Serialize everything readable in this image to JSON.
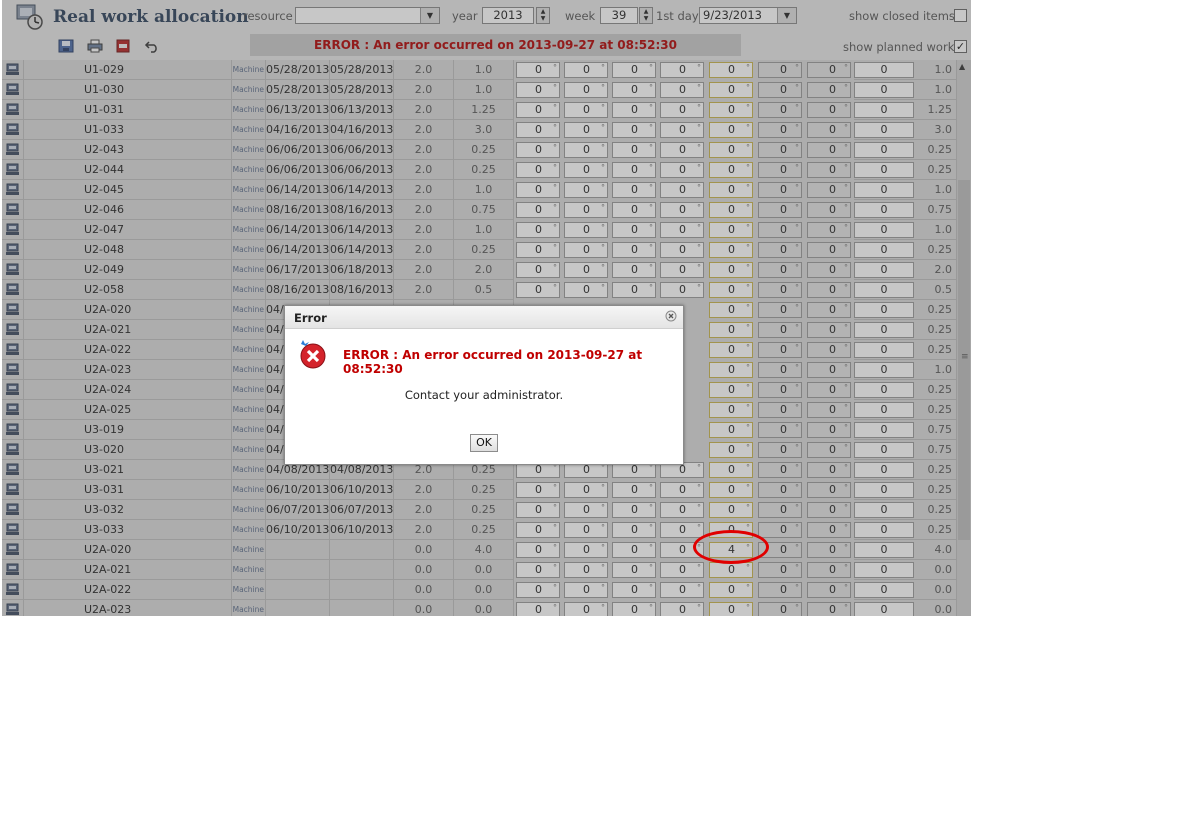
{
  "header": {
    "title": "Real work allocation",
    "resource_label": "resource",
    "resource_value": "",
    "year_label": "year",
    "year_value": "2013",
    "week_label": "week",
    "week_value": "39",
    "first_day_label": "1st day",
    "first_day_value": "9/23/2013",
    "show_closed_label": "show closed items",
    "show_closed_checked": false
  },
  "toolbar": {
    "icons": [
      "save-icon",
      "print-icon",
      "pdf-icon",
      "undo-icon"
    ],
    "error_text": "ERROR : An error occurred on 2013-09-27 at 08:52:30",
    "show_planned_label": "show planned work",
    "show_planned_checked": true
  },
  "grid": {
    "rows": [
      {
        "name": "U1-029",
        "type": "Machine",
        "start": "05/28/2013",
        "end": "05/28/2013",
        "v1": "2.0",
        "v2": "1.0",
        "days": [
          "0",
          "0",
          "0",
          "0",
          "0",
          "0",
          "0",
          "0"
        ],
        "total": "1.0"
      },
      {
        "name": "U1-030",
        "type": "Machine",
        "start": "05/28/2013",
        "end": "05/28/2013",
        "v1": "2.0",
        "v2": "1.0",
        "days": [
          "0",
          "0",
          "0",
          "0",
          "0",
          "0",
          "0",
          "0"
        ],
        "total": "1.0"
      },
      {
        "name": "U1-031",
        "type": "Machine",
        "start": "06/13/2013",
        "end": "06/13/2013",
        "v1": "2.0",
        "v2": "1.25",
        "days": [
          "0",
          "0",
          "0",
          "0",
          "0",
          "0",
          "0",
          "0"
        ],
        "total": "1.25"
      },
      {
        "name": "U1-033",
        "type": "Machine",
        "start": "04/16/2013",
        "end": "04/16/2013",
        "v1": "2.0",
        "v2": "3.0",
        "days": [
          "0",
          "0",
          "0",
          "0",
          "0",
          "0",
          "0",
          "0"
        ],
        "total": "3.0"
      },
      {
        "name": "U2-043",
        "type": "Machine",
        "start": "06/06/2013",
        "end": "06/06/2013",
        "v1": "2.0",
        "v2": "0.25",
        "days": [
          "0",
          "0",
          "0",
          "0",
          "0",
          "0",
          "0",
          "0"
        ],
        "total": "0.25"
      },
      {
        "name": "U2-044",
        "type": "Machine",
        "start": "06/06/2013",
        "end": "06/06/2013",
        "v1": "2.0",
        "v2": "0.25",
        "days": [
          "0",
          "0",
          "0",
          "0",
          "0",
          "0",
          "0",
          "0"
        ],
        "total": "0.25"
      },
      {
        "name": "U2-045",
        "type": "Machine",
        "start": "06/14/2013",
        "end": "06/14/2013",
        "v1": "2.0",
        "v2": "1.0",
        "days": [
          "0",
          "0",
          "0",
          "0",
          "0",
          "0",
          "0",
          "0"
        ],
        "total": "1.0"
      },
      {
        "name": "U2-046",
        "type": "Machine",
        "start": "08/16/2013",
        "end": "08/16/2013",
        "v1": "2.0",
        "v2": "0.75",
        "days": [
          "0",
          "0",
          "0",
          "0",
          "0",
          "0",
          "0",
          "0"
        ],
        "total": "0.75"
      },
      {
        "name": "U2-047",
        "type": "Machine",
        "start": "06/14/2013",
        "end": "06/14/2013",
        "v1": "2.0",
        "v2": "1.0",
        "days": [
          "0",
          "0",
          "0",
          "0",
          "0",
          "0",
          "0",
          "0"
        ],
        "total": "1.0"
      },
      {
        "name": "U2-048",
        "type": "Machine",
        "start": "06/14/2013",
        "end": "06/14/2013",
        "v1": "2.0",
        "v2": "0.25",
        "days": [
          "0",
          "0",
          "0",
          "0",
          "0",
          "0",
          "0",
          "0"
        ],
        "total": "0.25"
      },
      {
        "name": "U2-049",
        "type": "Machine",
        "start": "06/17/2013",
        "end": "06/18/2013",
        "v1": "2.0",
        "v2": "2.0",
        "days": [
          "0",
          "0",
          "0",
          "0",
          "0",
          "0",
          "0",
          "0"
        ],
        "total": "2.0"
      },
      {
        "name": "U2-058",
        "type": "Machine",
        "start": "08/16/2013",
        "end": "08/16/2013",
        "v1": "2.0",
        "v2": "0.5",
        "days": [
          "0",
          "0",
          "0",
          "0",
          "0",
          "0",
          "0",
          "0"
        ],
        "total": "0.5"
      },
      {
        "name": "U2A-020",
        "type": "Machine",
        "start": "04/",
        "end": "",
        "v1": "",
        "v2": "",
        "days": [
          "",
          "",
          "",
          "",
          "0",
          "0",
          "0",
          "0"
        ],
        "total": "0.25"
      },
      {
        "name": "U2A-021",
        "type": "Machine",
        "start": "04/",
        "end": "",
        "v1": "",
        "v2": "",
        "days": [
          "",
          "",
          "",
          "",
          "0",
          "0",
          "0",
          "0"
        ],
        "total": "0.25"
      },
      {
        "name": "U2A-022",
        "type": "Machine",
        "start": "04/",
        "end": "",
        "v1": "",
        "v2": "",
        "days": [
          "",
          "",
          "",
          "",
          "0",
          "0",
          "0",
          "0"
        ],
        "total": "0.25"
      },
      {
        "name": "U2A-023",
        "type": "Machine",
        "start": "04/",
        "end": "",
        "v1": "",
        "v2": "",
        "days": [
          "",
          "",
          "",
          "",
          "0",
          "0",
          "0",
          "0"
        ],
        "total": "1.0"
      },
      {
        "name": "U2A-024",
        "type": "Machine",
        "start": "04/",
        "end": "",
        "v1": "",
        "v2": "",
        "days": [
          "",
          "",
          "",
          "",
          "0",
          "0",
          "0",
          "0"
        ],
        "total": "0.25"
      },
      {
        "name": "U2A-025",
        "type": "Machine",
        "start": "04/",
        "end": "",
        "v1": "",
        "v2": "",
        "days": [
          "",
          "",
          "",
          "",
          "0",
          "0",
          "0",
          "0"
        ],
        "total": "0.25"
      },
      {
        "name": "U3-019",
        "type": "Machine",
        "start": "04/",
        "end": "",
        "v1": "",
        "v2": "",
        "days": [
          "",
          "",
          "",
          "",
          "0",
          "0",
          "0",
          "0"
        ],
        "total": "0.75"
      },
      {
        "name": "U3-020",
        "type": "Machine",
        "start": "04/",
        "end": "",
        "v1": "",
        "v2": "",
        "days": [
          "",
          "",
          "",
          "",
          "0",
          "0",
          "0",
          "0"
        ],
        "total": "0.75"
      },
      {
        "name": "U3-021",
        "type": "Machine",
        "start": "04/08/2013",
        "end": "04/08/2013",
        "v1": "2.0",
        "v2": "0.25",
        "days": [
          "0",
          "0",
          "0",
          "0",
          "0",
          "0",
          "0",
          "0"
        ],
        "total": "0.25"
      },
      {
        "name": "U3-031",
        "type": "Machine",
        "start": "06/10/2013",
        "end": "06/10/2013",
        "v1": "2.0",
        "v2": "0.25",
        "days": [
          "0",
          "0",
          "0",
          "0",
          "0",
          "0",
          "0",
          "0"
        ],
        "total": "0.25"
      },
      {
        "name": "U3-032",
        "type": "Machine",
        "start": "06/07/2013",
        "end": "06/07/2013",
        "v1": "2.0",
        "v2": "0.25",
        "days": [
          "0",
          "0",
          "0",
          "0",
          "0",
          "0",
          "0",
          "0"
        ],
        "total": "0.25"
      },
      {
        "name": "U3-033",
        "type": "Machine",
        "start": "06/10/2013",
        "end": "06/10/2013",
        "v1": "2.0",
        "v2": "0.25",
        "days": [
          "0",
          "0",
          "0",
          "0",
          "0",
          "0",
          "0",
          "0"
        ],
        "total": "0.25"
      },
      {
        "name": "U2A-020",
        "type": "Machine",
        "start": "",
        "end": "",
        "v1": "0.0",
        "v2": "4.0",
        "days": [
          "0",
          "0",
          "0",
          "0",
          "4",
          "0",
          "0",
          "0"
        ],
        "total": "4.0"
      },
      {
        "name": "U2A-021",
        "type": "Machine",
        "start": "",
        "end": "",
        "v1": "0.0",
        "v2": "0.0",
        "days": [
          "0",
          "0",
          "0",
          "0",
          "0",
          "0",
          "0",
          "0"
        ],
        "total": "0.0"
      },
      {
        "name": "U2A-022",
        "type": "Machine",
        "start": "",
        "end": "",
        "v1": "0.0",
        "v2": "0.0",
        "days": [
          "0",
          "0",
          "0",
          "0",
          "0",
          "0",
          "0",
          "0"
        ],
        "total": "0.0"
      },
      {
        "name": "U2A-023",
        "type": "Machine",
        "start": "",
        "end": "",
        "v1": "0.0",
        "v2": "0.0",
        "days": [
          "0",
          "0",
          "0",
          "0",
          "0",
          "0",
          "0",
          "0"
        ],
        "total": "0.0"
      }
    ]
  },
  "dialog": {
    "title": "Error",
    "message": "ERROR : An error occurred on 2013-09-27 at 08:52:30",
    "detail": "Contact your administrator.",
    "ok_label": "OK"
  },
  "colors": {
    "error_red": "#c00000",
    "title_blue": "#2a3f5a",
    "annotation_red": "#e00000"
  }
}
